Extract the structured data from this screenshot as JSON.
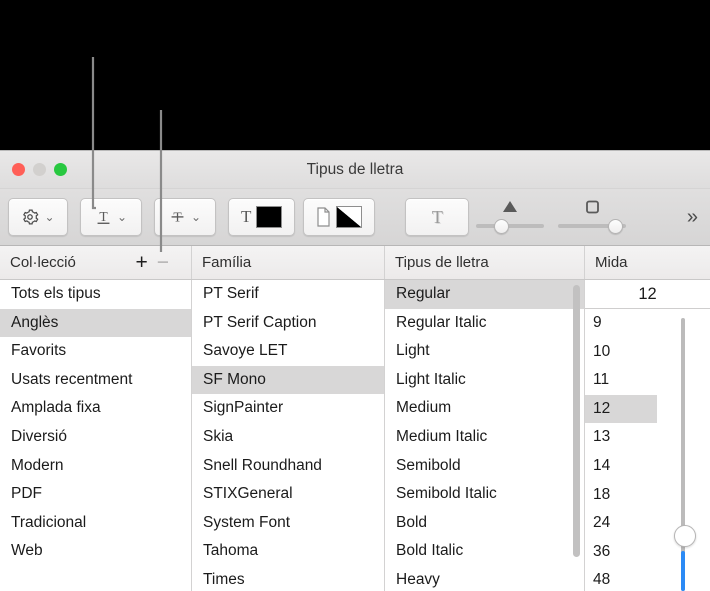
{
  "window": {
    "title": "Tipus de lletra",
    "traffic_lights": [
      "close",
      "minimize",
      "zoom"
    ]
  },
  "toolbar": {
    "settings_button": {
      "icon": "gear-icon",
      "chevron": "⌄"
    },
    "underline_button": {
      "icon": "underline-text-icon",
      "label": "T",
      "chevron": "⌄"
    },
    "strikethrough_button": {
      "icon": "strikethrough-text-icon",
      "label": "T",
      "chevron": "⌄"
    },
    "text_color_button": {
      "icon": "text-color-icon",
      "label": "T",
      "swatch": "#000000"
    },
    "document_color_button": {
      "icon": "document-color-icon"
    },
    "shadow_button": {
      "icon": "text-shadow-icon",
      "label": "T"
    },
    "shadow_opacity_slider": {
      "icon": "triangle-icon",
      "value": 30
    },
    "shadow_offset_slider": {
      "icon": "square-icon",
      "value": 80
    },
    "overflow_button": {
      "label": "»"
    }
  },
  "columns": {
    "collection": "Col·lecció",
    "family": "Família",
    "typeface": "Tipus de lletra",
    "size": "Mida",
    "add_label": "+",
    "remove_label": "−"
  },
  "collections": {
    "items": [
      "Tots els tipus",
      "Anglès",
      "Favorits",
      "Usats recentment",
      "Amplada fixa",
      "Diversió",
      "Modern",
      "PDF",
      "Tradicional",
      "Web"
    ],
    "selected": "Anglès"
  },
  "families": {
    "items": [
      "PT Serif",
      "PT Serif Caption",
      "Savoye LET",
      "SF Mono",
      "SignPainter",
      "Skia",
      "Snell Roundhand",
      "STIXGeneral",
      "System Font",
      "Tahoma",
      "Times"
    ],
    "selected": "SF Mono"
  },
  "typefaces": {
    "items": [
      "Regular",
      "Regular Italic",
      "Light",
      "Light Italic",
      "Medium",
      "Medium Italic",
      "Semibold",
      "Semibold Italic",
      "Bold",
      "Bold Italic",
      "Heavy"
    ],
    "selected": "Regular"
  },
  "sizes": {
    "field_value": "12",
    "items": [
      "9",
      "10",
      "11",
      "12",
      "13",
      "14",
      "18",
      "24",
      "36",
      "48"
    ],
    "selected": "12"
  },
  "colors": {
    "accent_blue": "#2b8af5",
    "selection_gray": "#d8d7d7",
    "traffic_close": "#ff5f57",
    "traffic_min": "#d2d0ce",
    "traffic_max": "#28c840"
  },
  "callouts": [
    {
      "name": "callout-to-settings-button"
    },
    {
      "name": "callout-to-add-collection-button"
    }
  ]
}
